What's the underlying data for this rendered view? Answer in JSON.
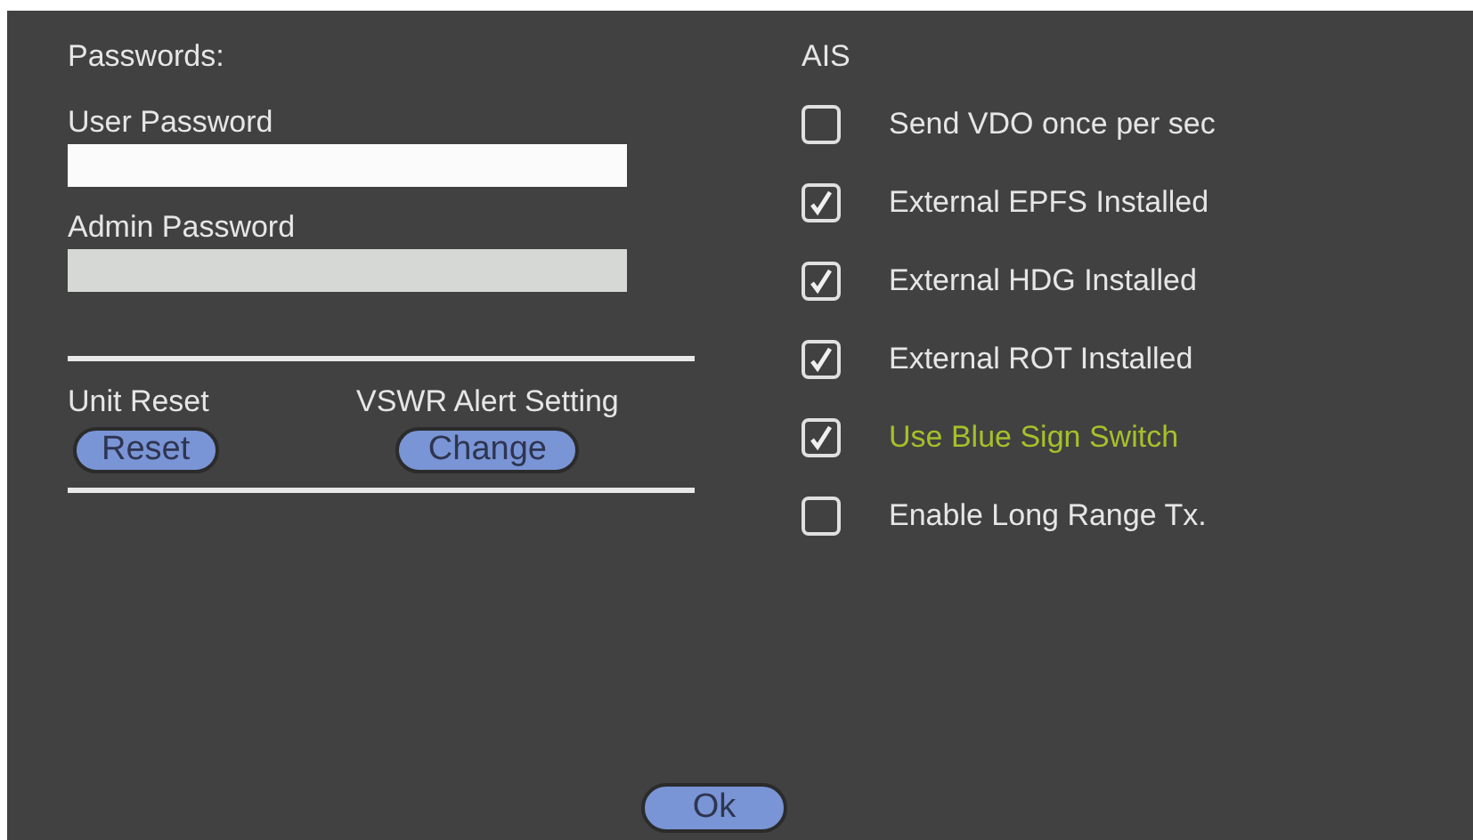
{
  "passwords": {
    "title": "Passwords:",
    "fields": [
      {
        "label": "User Password",
        "disabled": false
      },
      {
        "label": "Admin Password",
        "disabled": true
      }
    ]
  },
  "actions": [
    {
      "label": "Unit Reset",
      "button": "Reset"
    },
    {
      "label": "VSWR Alert Setting",
      "button": "Change"
    }
  ],
  "ais": {
    "title": "AIS",
    "options": [
      {
        "label": "Send VDO once per sec",
        "checked": false,
        "highlighted": false
      },
      {
        "label": "External EPFS Installed",
        "checked": true,
        "highlighted": false
      },
      {
        "label": "External HDG Installed",
        "checked": true,
        "highlighted": false
      },
      {
        "label": "External ROT Installed",
        "checked": true,
        "highlighted": false
      },
      {
        "label": "Use Blue Sign Switch",
        "checked": true,
        "highlighted": true
      },
      {
        "label": "Enable Long Range Tx.",
        "checked": false,
        "highlighted": false
      }
    ]
  },
  "buttons": [
    "Ok"
  ]
}
